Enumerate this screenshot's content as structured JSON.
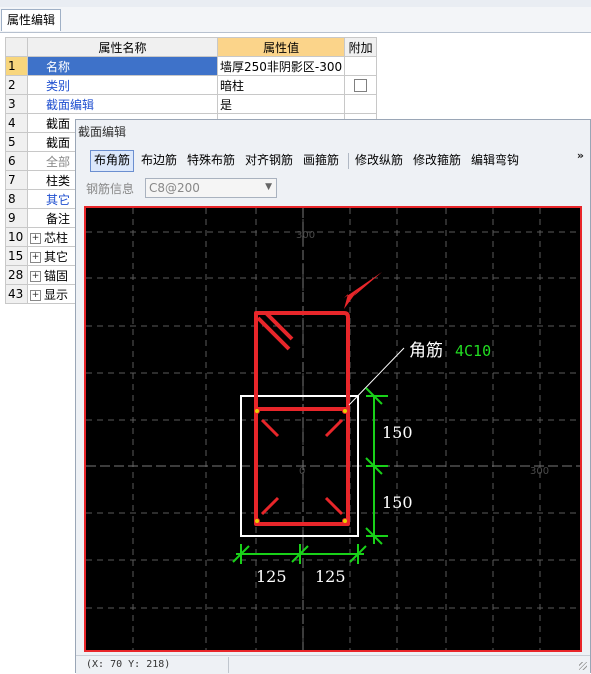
{
  "tab_label": "属性编辑",
  "table": {
    "headers": [
      "属性名称",
      "属性值",
      "附加"
    ],
    "rows": [
      {
        "no": "1",
        "name": "名称",
        "value": "墙厚250非阴影区-300",
        "style": "blue",
        "selected": true
      },
      {
        "no": "2",
        "name": "类别",
        "value": "暗柱",
        "style": "blue",
        "checkbox": true
      },
      {
        "no": "3",
        "name": "截面编辑",
        "value": "是",
        "style": "blue"
      },
      {
        "no": "4",
        "name": "截面",
        "value": ""
      },
      {
        "no": "5",
        "name": "截面",
        "value": ""
      },
      {
        "no": "6",
        "name": "全部",
        "value": "",
        "style": "gray"
      },
      {
        "no": "7",
        "name": "柱类",
        "value": ""
      },
      {
        "no": "8",
        "name": "其它",
        "value": "",
        "style": "blue"
      },
      {
        "no": "9",
        "name": "备注",
        "value": ""
      },
      {
        "no": "10",
        "name": "芯柱",
        "value": "",
        "expander": true
      },
      {
        "no": "15",
        "name": "其它",
        "value": "",
        "expander": true
      },
      {
        "no": "28",
        "name": "锚固",
        "value": "",
        "expander": true
      },
      {
        "no": "43",
        "name": "显示",
        "value": "",
        "expander": true
      }
    ]
  },
  "dialog": {
    "title": "截面编辑",
    "toolbar": [
      "布角筋",
      "布边筋",
      "特殊布筋",
      "对齐钢筋",
      "画箍筋",
      "修改纵筋",
      "修改箍筋",
      "编辑弯钩"
    ],
    "active_tool": "布角筋",
    "more": "»",
    "rebar_info_label": "钢筋信息",
    "rebar_info_value": "C8@200",
    "axis_labels": {
      "top": "300",
      "right": "300",
      "center": "0"
    },
    "annotation": {
      "label": "角筋",
      "spec": "4C10"
    },
    "dims": {
      "vertical": [
        "150",
        "150"
      ],
      "horizontal": [
        "125",
        "125"
      ]
    },
    "status": "(X: 70 Y: 218)"
  },
  "colors": {
    "rebar": "#e8262a",
    "dimension": "#19d119",
    "spec": "#22dd22",
    "canvas": "#000000",
    "outline": "#ffffff",
    "header_value": "#fbd48a",
    "selection": "#3e72c9"
  }
}
